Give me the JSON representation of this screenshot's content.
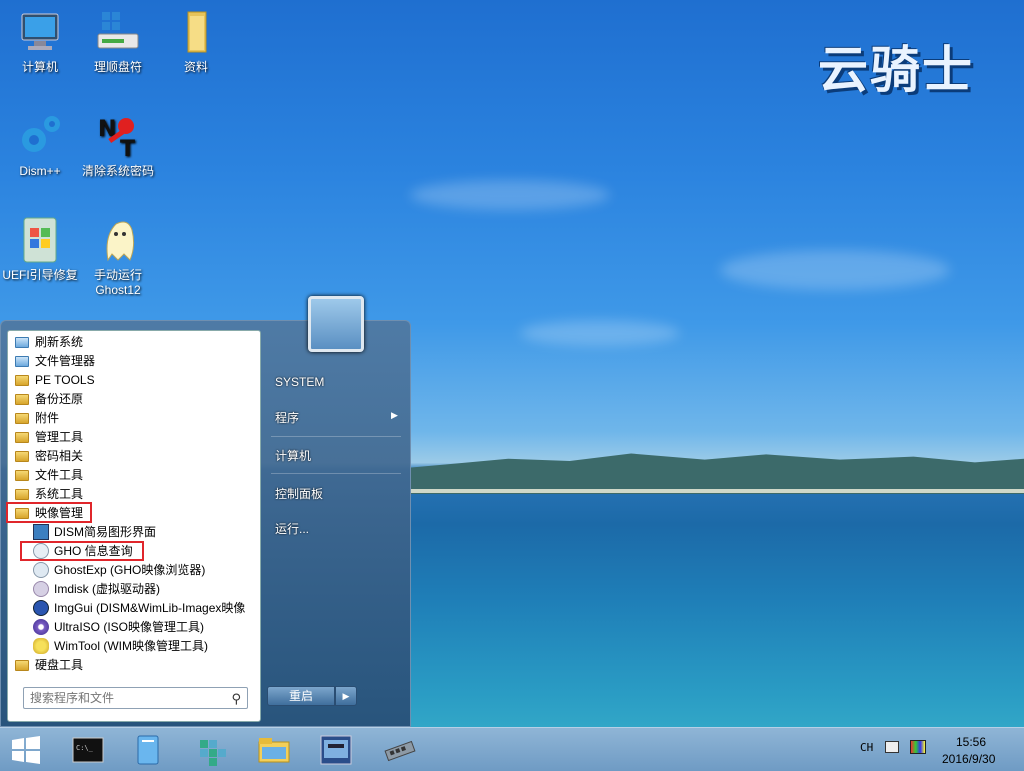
{
  "desktop": {
    "brand": "云骑士",
    "icons": [
      {
        "label": "计算机",
        "icon": "computer-icon"
      },
      {
        "label": "理顺盘符",
        "icon": "drive-icon"
      },
      {
        "label": "资料",
        "icon": "folder-icon"
      },
      {
        "label": "Dism++",
        "icon": "gear-icon"
      },
      {
        "label": "清除系统密码",
        "icon": "nt-password-icon"
      },
      {
        "label": "UEFI引导修复",
        "icon": "uefi-icon"
      },
      {
        "label": "手动运行\nGhost12",
        "label_line1": "手动运行",
        "label_line2": "Ghost12",
        "icon": "ghost-icon"
      }
    ]
  },
  "start_menu": {
    "items": [
      {
        "label": "刷新系统",
        "icon": "blue-folder-icon"
      },
      {
        "label": "文件管理器",
        "icon": "blue-folder-icon"
      },
      {
        "label": "PE TOOLS",
        "icon": "folder-icon"
      },
      {
        "label": "备份还原",
        "icon": "folder-icon"
      },
      {
        "label": "附件",
        "icon": "folder-icon"
      },
      {
        "label": "管理工具",
        "icon": "folder-icon"
      },
      {
        "label": "密码相关",
        "icon": "folder-icon"
      },
      {
        "label": "文件工具",
        "icon": "folder-icon"
      },
      {
        "label": "系统工具",
        "icon": "folder-icon"
      },
      {
        "label": "映像管理",
        "icon": "folder-icon"
      },
      {
        "label": "DISM简易图形界面",
        "icon": "dism-icon"
      },
      {
        "label": "GHO 信息查询",
        "icon": "gho-icon"
      },
      {
        "label": "GhostExp (GHO映像浏览器)",
        "icon": "ghostexp-icon"
      },
      {
        "label": "Imdisk (虚拟驱动器)",
        "icon": "imdisk-icon"
      },
      {
        "label": "ImgGui (DISM&WimLib-Imagex映像",
        "icon": "imggui-icon"
      },
      {
        "label": "UltraISO (ISO映像管理工具)",
        "icon": "ultraiso-icon"
      },
      {
        "label": "WimTool (WIM映像管理工具)",
        "icon": "wimtool-icon"
      },
      {
        "label": "硬盘工具",
        "icon": "folder-icon"
      }
    ],
    "search_placeholder": "搜索程序和文件",
    "right": {
      "user": "SYSTEM",
      "programs": "程序",
      "computer": "计算机",
      "control_panel": "控制面板",
      "run": "运行..."
    },
    "restart": "重启"
  },
  "taskbar": {
    "input_indicator": "CH",
    "time": "15:56",
    "date": "2016/9/30"
  },
  "colors": {
    "highlight": "#e0262b"
  }
}
